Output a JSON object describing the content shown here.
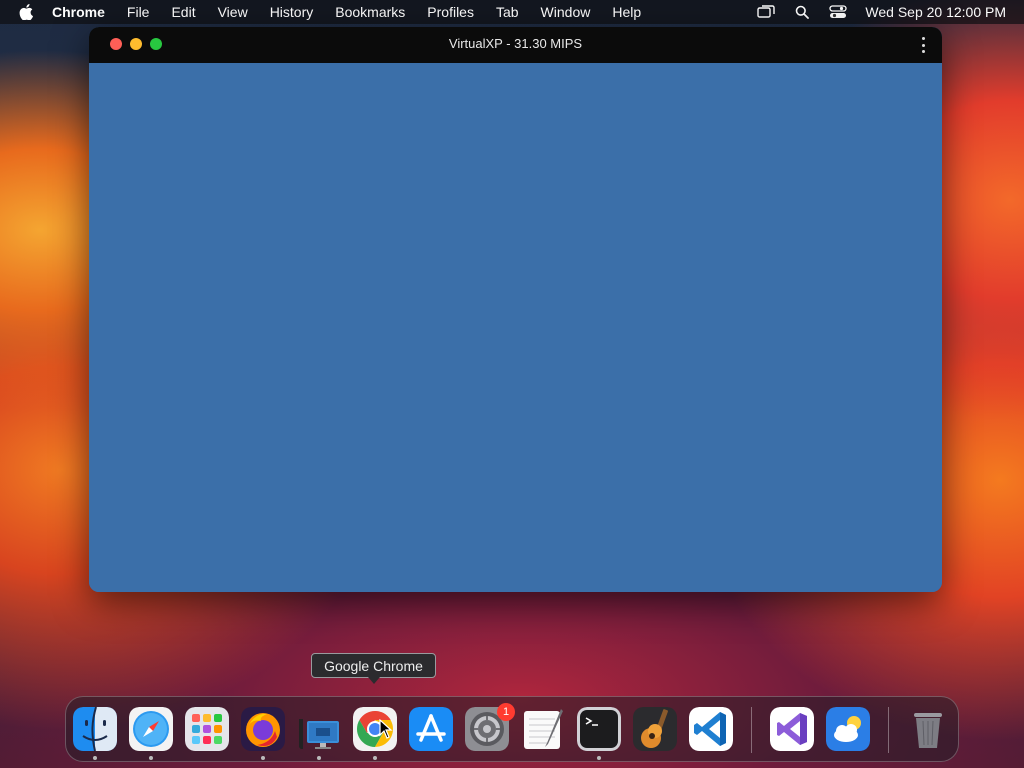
{
  "menubar": {
    "app_name": "Chrome",
    "menus": [
      "File",
      "Edit",
      "View",
      "History",
      "Bookmarks",
      "Profiles",
      "Tab",
      "Window",
      "Help"
    ],
    "datetime": "Wed Sep 20  12:00 PM",
    "icons": [
      "apple-icon",
      "screen-mirror-icon",
      "spotlight-search-icon",
      "control-center-icon"
    ]
  },
  "window": {
    "title": "VirtualXP - 31.30 MIPS",
    "content_color": "#3b6fa9",
    "traffic_lights": [
      "close",
      "minimize",
      "maximize"
    ]
  },
  "tooltip": {
    "text": "Google Chrome"
  },
  "dock": {
    "apps": [
      {
        "name": "Finder",
        "icon": "finder-icon",
        "running": true
      },
      {
        "name": "Safari",
        "icon": "safari-icon",
        "running": true
      },
      {
        "name": "Launchpad",
        "icon": "launchpad-icon",
        "running": false
      },
      {
        "name": "Firefox",
        "icon": "firefox-icon",
        "running": true
      },
      {
        "name": "Remote Desktop",
        "icon": "remote-desktop-icon",
        "running": true
      },
      {
        "name": "Google Chrome",
        "icon": "chrome-icon",
        "running": true
      },
      {
        "name": "App Store",
        "icon": "app-store-icon",
        "running": false
      },
      {
        "name": "System Preferences",
        "icon": "system-preferences-icon",
        "running": false,
        "badge": "1"
      },
      {
        "name": "TextEdit",
        "icon": "textedit-icon",
        "running": false
      },
      {
        "name": "Terminal",
        "icon": "terminal-icon",
        "running": true
      },
      {
        "name": "GarageBand",
        "icon": "garageband-icon",
        "running": false
      },
      {
        "name": "Visual Studio Code",
        "icon": "vscode-icon",
        "running": false
      },
      {
        "name": "Visual Studio",
        "icon": "visual-studio-icon",
        "running": false
      },
      {
        "name": "Weather",
        "icon": "weather-icon",
        "running": false
      },
      {
        "name": "Trash",
        "icon": "trash-icon",
        "running": false
      }
    ]
  }
}
